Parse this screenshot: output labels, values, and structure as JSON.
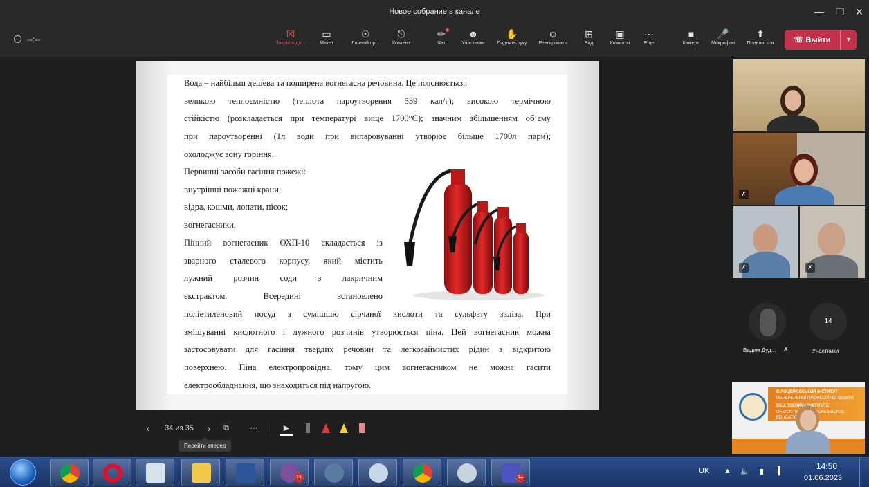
{
  "window": {
    "title": "Новое собрание в канале"
  },
  "toolbar": {
    "timer": "--:--",
    "buttons": [
      {
        "id": "close-content",
        "label": "Закрыть до..."
      },
      {
        "id": "layout",
        "label": "Макет"
      },
      {
        "id": "personal",
        "label": "Личный пр..."
      },
      {
        "id": "content",
        "label": "Контент"
      },
      {
        "id": "chat",
        "label": "Чат"
      },
      {
        "id": "participants",
        "label": "Участники"
      },
      {
        "id": "raise-hand",
        "label": "Поднять руку"
      },
      {
        "id": "react",
        "label": "Реагировать"
      },
      {
        "id": "view",
        "label": "Вид"
      },
      {
        "id": "rooms",
        "label": "Комнаты"
      },
      {
        "id": "more",
        "label": "Еще"
      },
      {
        "id": "camera",
        "label": "Камера"
      },
      {
        "id": "mic",
        "label": "Микрофон"
      },
      {
        "id": "share",
        "label": "Поделиться"
      }
    ],
    "leave": "Выйти"
  },
  "slide": {
    "lines": [
      "Вода – найбільш дешева та поширена вогнегасна речовина. Це пояснюється:",
      "великою теплоємністю (теплота пароутворення 539 кал/г); високою термічною",
      "стійкістю (розкладається при температурі вище 1700°С); значним збільшенням об’єму",
      "при пароутворенні (1л води при випаровуванні утворює більше 1700л пари);",
      "охолоджує зону горіння.",
      "Первинні засоби гасіння пожежі:",
      "внутрішні пожежні крани;",
      "відра, кошми, лопати, пісок;",
      "вогнегасники.",
      "Пінний вогнегасник ОХП-10 складається із",
      "зварного сталевого корпусу, який містить",
      "лужний розчин соди з лакричним",
      "екстрактом. Всередині встановлено",
      "поліетиленовий посуд з сумішшю сірчаної кислоти та сульфату заліза. При",
      "змішуванні кислотного і лужного розчинів утворюється піна. Цей вогнегасник можна",
      "застосовувати для гасіння твердих речовин та легкозаймистих рідин з відкритою",
      "поверхнею. Піна електропровідна, тому цим вогнегасником не можна гасити",
      "електрообладнання, що знаходиться під напругою."
    ]
  },
  "slide_controls": {
    "counter": "34 из 35",
    "tooltip": "Перейти вперед"
  },
  "participants": {
    "vadym_name": "Вадим Дуд...",
    "count": "14",
    "label": "Участники"
  },
  "institute": {
    "line1": "БІЛОЦЕРКІВСЬКИЙ ІНСТИТУТ",
    "line2": "НЕПЕРЕРВНОЇ ПРОФЕСІЙНОЇ ОСВІТИ",
    "line3": "BILA TSERKVA INSTITUTE",
    "line4": "OF CONTINUOUS PROFESSIONAL",
    "line5": "EDUCATION"
  },
  "taskbar": {
    "lang": "UK",
    "time": "14:50",
    "date": "01.06.2023",
    "viber_badge": "11",
    "teams_badge": "9+"
  }
}
